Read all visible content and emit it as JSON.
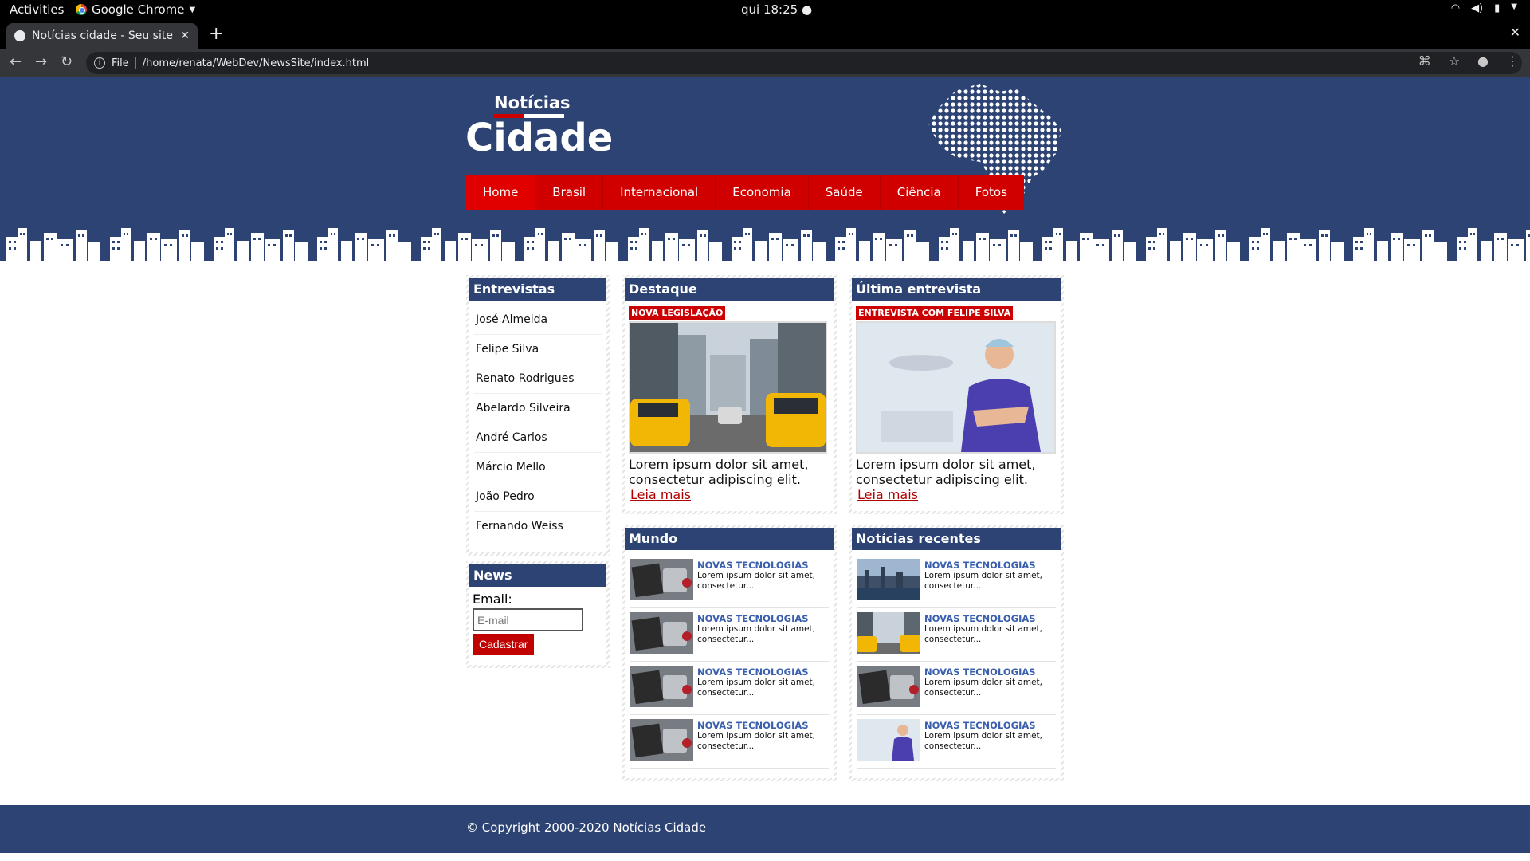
{
  "desktop": {
    "activities": "Activities",
    "app_name": "Google Chrome",
    "clock": "qui 18:25 ●"
  },
  "browser": {
    "tab_title": "Notícias cidade - Seu site d",
    "omnibox_scheme": "File",
    "url": "/home/renata/WebDev/NewsSite/index.html"
  },
  "site": {
    "logo_small": "Notícias",
    "logo_big": "Cidade",
    "menu": [
      "Home",
      "Brasil",
      "Internacional",
      "Economia",
      "Saúde",
      "Ciência",
      "Fotos"
    ],
    "accent_color": "#d10000",
    "brand_color": "#2c4373"
  },
  "interviews": {
    "title": "Entrevistas",
    "items": [
      "José Almeida",
      "Felipe Silva",
      "Renato Rodrigues",
      "Abelardo Silveira",
      "André Carlos",
      "Márcio Mello",
      "João Pedro",
      "Fernando Weiss"
    ]
  },
  "newsletter": {
    "title": "News",
    "email_label": "Email:",
    "email_placeholder": "E-mail",
    "submit_label": "Cadastrar"
  },
  "highlight": {
    "title": "Destaque",
    "tag": "NOVA LEGISLAÇÃO",
    "text": "Lorem ipsum dolor sit amet, consectetur adipiscing elit.",
    "more": "Leia mais"
  },
  "last_interview": {
    "title": "Última entrevista",
    "tag": "ENTREVISTA COM FELIPE SILVA",
    "text": "Lorem ipsum dolor sit amet, consectetur adipiscing elit.",
    "more": "Leia mais"
  },
  "world": {
    "title": "Mundo",
    "items": [
      {
        "title": "NOVAS TECNOLOGIAS",
        "text": "Lorem ipsum dolor sit amet, consectetur...",
        "thumb": "desk-notebook"
      },
      {
        "title": "NOVAS TECNOLOGIAS",
        "text": "Lorem ipsum dolor sit amet, consectetur...",
        "thumb": "desk-notebook"
      },
      {
        "title": "NOVAS TECNOLOGIAS",
        "text": "Lorem ipsum dolor sit amet, consectetur...",
        "thumb": "desk-notebook"
      },
      {
        "title": "NOVAS TECNOLOGIAS",
        "text": "Lorem ipsum dolor sit amet, consectetur...",
        "thumb": "desk-notebook"
      }
    ]
  },
  "recent": {
    "title": "Notícias recentes",
    "items": [
      {
        "title": "NOVAS TECNOLOGIAS",
        "text": "Lorem ipsum dolor sit amet, consectetur...",
        "thumb": "city-skyline"
      },
      {
        "title": "NOVAS TECNOLOGIAS",
        "text": "Lorem ipsum dolor sit amet, consectetur...",
        "thumb": "taxi-street"
      },
      {
        "title": "NOVAS TECNOLOGIAS",
        "text": "Lorem ipsum dolor sit amet, consectetur...",
        "thumb": "desk-notebook"
      },
      {
        "title": "NOVAS TECNOLOGIAS",
        "text": "Lorem ipsum dolor sit amet, consectetur...",
        "thumb": "doctor"
      }
    ]
  },
  "footer": {
    "copyright": "© Copyright 2000-2020 Notícias Cidade"
  }
}
